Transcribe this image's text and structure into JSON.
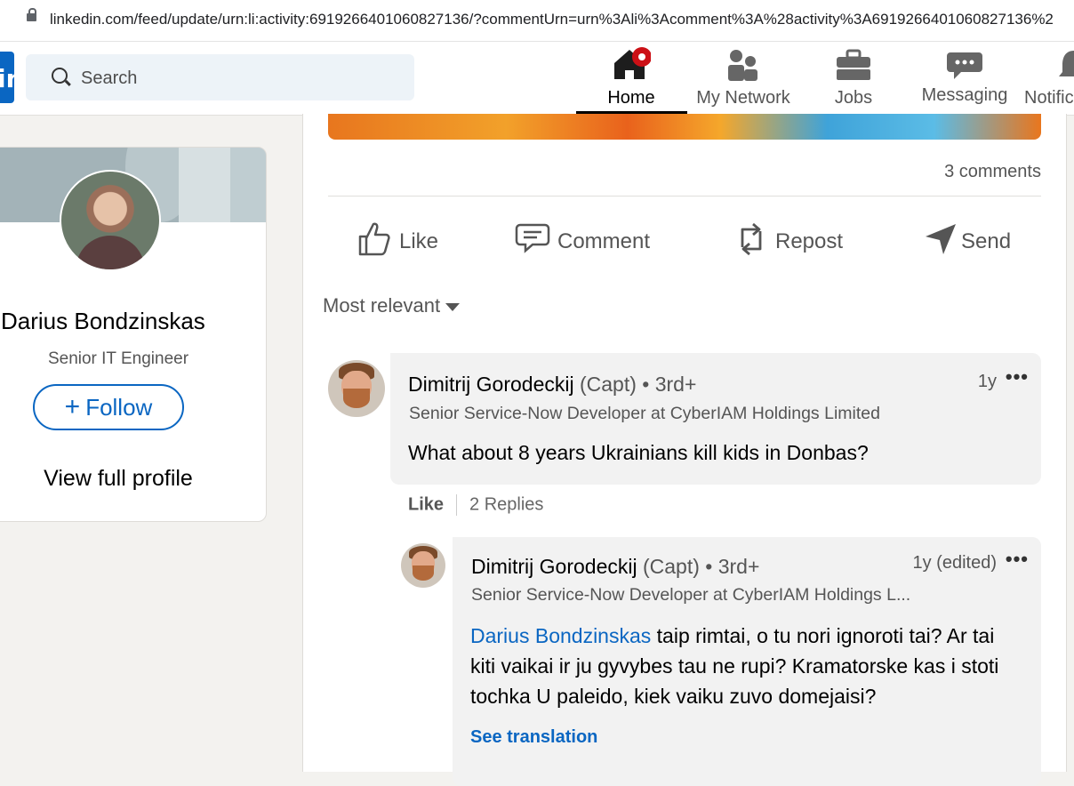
{
  "browser": {
    "url": "linkedin.com/feed/update/urn:li:activity:6919266401060827136/?commentUrn=urn%3Ali%3Acomment%3A%28activity%3A6919266401060827136%2"
  },
  "nav": {
    "search_placeholder": "Search",
    "items": [
      {
        "label": "Home",
        "icon": "home-icon",
        "active": true
      },
      {
        "label": "My Network",
        "icon": "network-icon"
      },
      {
        "label": "Jobs",
        "icon": "briefcase-icon"
      },
      {
        "label": "Messaging",
        "icon": "messaging-icon"
      },
      {
        "label": "Notifica",
        "icon": "bell-icon"
      }
    ]
  },
  "profile_card": {
    "name": "Darius Bondzinskas",
    "role": "Senior IT Engineer",
    "follow_label": "Follow",
    "view_full_label": "View full profile"
  },
  "post": {
    "comments_count": "3 comments",
    "actions": {
      "like": "Like",
      "comment": "Comment",
      "repost": "Repost",
      "send": "Send"
    },
    "sort_label": "Most relevant"
  },
  "comments": [
    {
      "author": "Dimitrij Gorodeckij",
      "pronoun": "(Capt)",
      "degree": "• 3rd+",
      "headline": "Senior Service-Now Developer at CyberIAM Holdings Limited",
      "time": "1y",
      "text": "What about 8 years Ukrainians kill kids in Donbas?",
      "like_label": "Like",
      "replies_label": "2 Replies"
    },
    {
      "author": "Dimitrij Gorodeckij",
      "pronoun": "(Capt)",
      "degree": "• 3rd+",
      "headline": "Senior Service-Now Developer at CyberIAM Holdings L...",
      "time": "1y (edited)",
      "mention": "Darius Bondzinskas",
      "text": " taip rimtai, o tu nori ignoroti tai? Ar tai kiti vaikai ir ju gyvybes tau ne rupi? Kramatorske kas i stoti tochka U paleido, kiek vaiku zuvo domejaisi?",
      "see_translation": "See translation"
    }
  ],
  "colors": {
    "brand": "#0a66c2",
    "badge": "#cc1016"
  }
}
